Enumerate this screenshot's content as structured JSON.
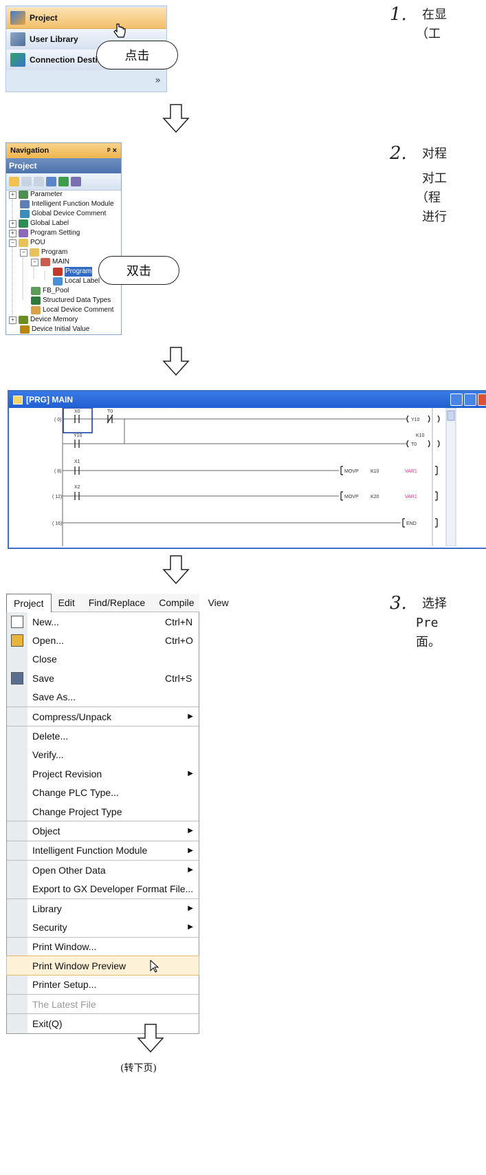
{
  "steps": [
    {
      "number": "1.",
      "text": [
        "在显",
        "（工"
      ]
    },
    {
      "number": "2.",
      "text": [
        "对程",
        "对工",
        "（程",
        "进行"
      ]
    },
    {
      "number": "3.",
      "text": [
        "选择",
        "Pre",
        "面。"
      ]
    }
  ],
  "panel1": {
    "items": [
      {
        "label": "Project"
      },
      {
        "label": "User Library"
      },
      {
        "label": "Connection Destina"
      }
    ],
    "more_glyph": "»",
    "callout": "点击"
  },
  "panel2": {
    "header_title": "Navigation",
    "header_controls": "ᵖ ×",
    "project_label": "Project",
    "tree": [
      {
        "label": "Parameter"
      },
      {
        "label": "Intelligent Function Module"
      },
      {
        "label": "Global Device Comment"
      },
      {
        "label": "Global Label"
      },
      {
        "label": "Program Setting"
      },
      {
        "label": "POU"
      },
      {
        "label": "Program"
      },
      {
        "label": "MAIN"
      },
      {
        "label": "Program"
      },
      {
        "label": "Local Label"
      },
      {
        "label": "FB_Pool"
      },
      {
        "label": "Structured Data Types"
      },
      {
        "label": "Local Device Comment"
      },
      {
        "label": "Device Memory"
      },
      {
        "label": "Device Initial Value"
      }
    ],
    "callout": "双击"
  },
  "panel3": {
    "title": "[PRG] MAIN",
    "rows": [
      {
        "step": "( 0)",
        "contacts": [
          "X0",
          "T0"
        ],
        "coil": "Y10"
      },
      {
        "step": "",
        "contacts": [
          "Y10"
        ],
        "coil": "T0",
        "coil_param": "K10"
      },
      {
        "step": "( 8)",
        "contacts": [
          "X1"
        ],
        "instr": "MOVP",
        "op1": "K10",
        "op2": "VAR1"
      },
      {
        "step": "( 12)",
        "contacts": [
          "X2"
        ],
        "instr": "MOVP",
        "op1": "K20",
        "op2": "VAR1"
      },
      {
        "step": "( 16)",
        "instr": "END"
      }
    ]
  },
  "panel4": {
    "menubar": [
      "Project",
      "Edit",
      "Find/Replace",
      "Compile",
      "View"
    ],
    "items": [
      {
        "label": "New...",
        "shortcut": "Ctrl+N",
        "icon": "new-file-icon"
      },
      {
        "label": "Open...",
        "shortcut": "Ctrl+O",
        "icon": "open-folder-icon"
      },
      {
        "label": "Close",
        "shortcut": ""
      },
      {
        "label": "Save",
        "shortcut": "Ctrl+S",
        "icon": "save-disk-icon"
      },
      {
        "label": "Save As...",
        "shortcut": ""
      },
      {
        "label": "Compress/Unpack",
        "submenu": true,
        "sep": true
      },
      {
        "label": "Delete...",
        "sep": true
      },
      {
        "label": "Verify..."
      },
      {
        "label": "Project Revision",
        "submenu": true
      },
      {
        "label": "Change PLC Type..."
      },
      {
        "label": "Change Project Type"
      },
      {
        "label": "Object",
        "submenu": true,
        "sep": true
      },
      {
        "label": "Intelligent Function Module",
        "submenu": true,
        "sep": true
      },
      {
        "label": "Open Other Data",
        "submenu": true,
        "sep": true
      },
      {
        "label": "Export to GX Developer Format File..."
      },
      {
        "label": "Library",
        "submenu": true,
        "sep": true
      },
      {
        "label": "Security",
        "submenu": true
      },
      {
        "label": "Print Window...",
        "sep": true
      },
      {
        "label": "Print Window Preview",
        "highlighted": true
      },
      {
        "label": "Printer Setup..."
      },
      {
        "label": "The Latest File",
        "disabled": true,
        "sep": true
      },
      {
        "label": "Exit(Q)",
        "sep": true
      }
    ],
    "submenu_glyph": "▶"
  },
  "footer": "(转下页)",
  "colors": {
    "accent_orange": "#f0b54f",
    "title_blue": "#1f5fcf",
    "menu_highlight": "#fdf1d8"
  }
}
